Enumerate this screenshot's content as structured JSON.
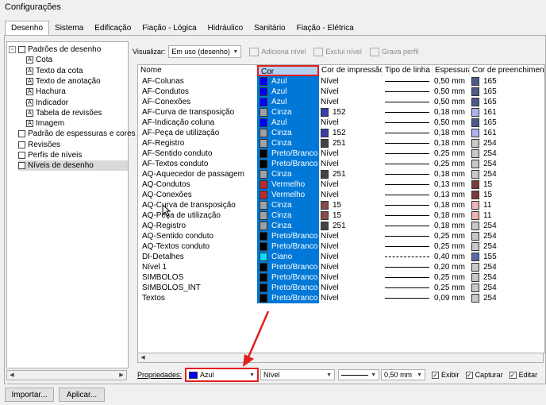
{
  "window": {
    "title": "Configurações"
  },
  "tabs": [
    "Desenho",
    "Sistema",
    "Edificação",
    "Fiação - Lógica",
    "Hidráulico",
    "Sanitário",
    "Fiação - Elétrica"
  ],
  "tree": {
    "items": [
      {
        "label": "Padrões de desenho",
        "icon": "folder-icon",
        "level": 0,
        "expanded": true
      },
      {
        "label": "Cota",
        "icon": "dimension-icon",
        "level": 1
      },
      {
        "label": "Texto da cota",
        "icon": "text-icon",
        "level": 1
      },
      {
        "label": "Texto de anotação",
        "icon": "text-icon",
        "level": 1
      },
      {
        "label": "Hachura",
        "icon": "hatch-icon",
        "level": 1
      },
      {
        "label": "Indicador",
        "icon": "indicator-icon",
        "level": 1
      },
      {
        "label": "Tabela de revisões",
        "icon": "table-icon",
        "level": 1
      },
      {
        "label": "Imagem",
        "icon": "image-icon",
        "level": 1
      },
      {
        "label": "Padrão de espessuras e cores",
        "icon": "style-icon",
        "level": 0
      },
      {
        "label": "Revisões",
        "icon": "style-icon",
        "level": 0
      },
      {
        "label": "Perfis de níveis",
        "icon": "style-icon",
        "level": 0
      },
      {
        "label": "Níveis de desenho",
        "icon": "style-icon",
        "level": 0,
        "selected": true
      }
    ]
  },
  "toolbar": {
    "visualizar_label": "Visualizar:",
    "visualizar_value": "Em uso (desenho)",
    "adiciona": "Adiciona nível",
    "exclui": "Exclui nível",
    "grava": "Grava perfil"
  },
  "grid": {
    "columns": [
      "Nome",
      "Cor",
      "Cor de impressão",
      "Tipo de linha",
      "Espessura",
      "Cor de preenchimento"
    ],
    "rows": [
      {
        "nome": "AF-Colunas",
        "cor": "Azul",
        "cor_hex": "#0000ff",
        "impressao": "Nível",
        "imp_hex": "",
        "linha": "solid",
        "esp": "0,50 mm",
        "preench": "165",
        "pre_hex": "#4a5a8a"
      },
      {
        "nome": "AF-Condutos",
        "cor": "Azul",
        "cor_hex": "#0000ff",
        "impressao": "Nível",
        "imp_hex": "",
        "linha": "solid",
        "esp": "0,50 mm",
        "preench": "165",
        "pre_hex": "#4a5a8a"
      },
      {
        "nome": "AF-Conexões",
        "cor": "Azul",
        "cor_hex": "#0000ff",
        "impressao": "Nível",
        "imp_hex": "",
        "linha": "solid",
        "esp": "0,50 mm",
        "preench": "165",
        "pre_hex": "#4a5a8a"
      },
      {
        "nome": "AF-Curva de transposição",
        "cor": "Cinza",
        "cor_hex": "#a0a0a0",
        "impressao": "152",
        "imp_hex": "#3b3fa8",
        "linha": "solid",
        "esp": "0,18 mm",
        "preench": "161",
        "pre_hex": "#aab4f0"
      },
      {
        "nome": "AF-Indicação coluna",
        "cor": "Azul",
        "cor_hex": "#0000ff",
        "impressao": "Nível",
        "imp_hex": "",
        "linha": "solid",
        "esp": "0,50 mm",
        "preench": "165",
        "pre_hex": "#4a5a8a"
      },
      {
        "nome": "AF-Peça de utilização",
        "cor": "Cinza",
        "cor_hex": "#a0a0a0",
        "impressao": "152",
        "imp_hex": "#3b3fa8",
        "linha": "solid",
        "esp": "0,18 mm",
        "preench": "161",
        "pre_hex": "#aab4f0"
      },
      {
        "nome": "AF-Registro",
        "cor": "Cinza",
        "cor_hex": "#a0a0a0",
        "impressao": "251",
        "imp_hex": "#444444",
        "linha": "solid",
        "esp": "0,18 mm",
        "preench": "254",
        "pre_hex": "#c8c8c8"
      },
      {
        "nome": "AF-Sentido conduto",
        "cor": "Preto/Branco",
        "cor_hex": "#000000",
        "impressao": "Nível",
        "imp_hex": "",
        "linha": "solid",
        "esp": "0,25 mm",
        "preench": "254",
        "pre_hex": "#c8c8c8"
      },
      {
        "nome": "AF-Textos conduto",
        "cor": "Preto/Branco",
        "cor_hex": "#000000",
        "impressao": "Nível",
        "imp_hex": "",
        "linha": "solid",
        "esp": "0,25 mm",
        "preench": "254",
        "pre_hex": "#c8c8c8"
      },
      {
        "nome": "AQ-Aquecedor de passagem",
        "cor": "Cinza",
        "cor_hex": "#a0a0a0",
        "impressao": "251",
        "imp_hex": "#444444",
        "linha": "solid",
        "esp": "0,18 mm",
        "preench": "254",
        "pre_hex": "#c8c8c8"
      },
      {
        "nome": "AQ-Condutos",
        "cor": "Vermelho",
        "cor_hex": "#c0282d",
        "impressao": "Nível",
        "imp_hex": "",
        "linha": "solid",
        "esp": "0,13 mm",
        "preench": "15",
        "pre_hex": "#7a3a3a"
      },
      {
        "nome": "AQ-Conexões",
        "cor": "Vermelho",
        "cor_hex": "#c0282d",
        "impressao": "Nível",
        "imp_hex": "",
        "linha": "solid",
        "esp": "0,13 mm",
        "preench": "15",
        "pre_hex": "#7a3a3a"
      },
      {
        "nome": "AQ-Curva de transposição",
        "cor": "Cinza",
        "cor_hex": "#a0a0a0",
        "impressao": "15",
        "imp_hex": "#8a4a4a",
        "linha": "solid",
        "esp": "0,18 mm",
        "preench": "11",
        "pre_hex": "#f0b4b4"
      },
      {
        "nome": "AQ-Peça de utilização",
        "cor": "Cinza",
        "cor_hex": "#a0a0a0",
        "impressao": "15",
        "imp_hex": "#8a4a4a",
        "linha": "solid",
        "esp": "0,18 mm",
        "preench": "11",
        "pre_hex": "#f0b4b4"
      },
      {
        "nome": "AQ-Registro",
        "cor": "Cinza",
        "cor_hex": "#a0a0a0",
        "impressao": "251",
        "imp_hex": "#444444",
        "linha": "solid",
        "esp": "0,18 mm",
        "preench": "254",
        "pre_hex": "#c8c8c8"
      },
      {
        "nome": "AQ-Sentido conduto",
        "cor": "Preto/Branco",
        "cor_hex": "#000000",
        "impressao": "Nível",
        "imp_hex": "",
        "linha": "solid",
        "esp": "0,25 mm",
        "preench": "254",
        "pre_hex": "#c8c8c8"
      },
      {
        "nome": "AQ-Textos conduto",
        "cor": "Preto/Branco",
        "cor_hex": "#000000",
        "impressao": "Nível",
        "imp_hex": "",
        "linha": "solid",
        "esp": "0,25 mm",
        "preench": "254",
        "pre_hex": "#c8c8c8"
      },
      {
        "nome": "DI-Detalhes",
        "cor": "Ciano",
        "cor_hex": "#00e0ff",
        "impressao": "Nível",
        "imp_hex": "",
        "linha": "dashed",
        "esp": "0,40 mm",
        "preench": "155",
        "pre_hex": "#5a6aa8"
      },
      {
        "nome": "Nível 1",
        "cor": "Preto/Branco",
        "cor_hex": "#000000",
        "impressao": "Nível",
        "imp_hex": "",
        "linha": "solid",
        "esp": "0,20 mm",
        "preench": "254",
        "pre_hex": "#c8c8c8"
      },
      {
        "nome": "SIMBOLOS",
        "cor": "Preto/Branco",
        "cor_hex": "#000000",
        "impressao": "Nível",
        "imp_hex": "",
        "linha": "solid",
        "esp": "0,25 mm",
        "preench": "254",
        "pre_hex": "#c8c8c8"
      },
      {
        "nome": "SIMBOLOS_INT",
        "cor": "Preto/Branco",
        "cor_hex": "#000000",
        "impressao": "Nível",
        "imp_hex": "",
        "linha": "solid",
        "esp": "0,25 mm",
        "preench": "254",
        "pre_hex": "#c8c8c8"
      },
      {
        "nome": "Textos",
        "cor": "Preto/Branco",
        "cor_hex": "#000000",
        "impressao": "Nível",
        "imp_hex": "",
        "linha": "solid",
        "esp": "0,09 mm",
        "preench": "254",
        "pre_hex": "#c8c8c8"
      }
    ]
  },
  "properties": {
    "label": "Propriedades:",
    "color_value": "Azul",
    "color_hex": "#0000ff",
    "print_value": "Nível",
    "thickness": "0,50 mm",
    "exibir": "Exibir",
    "capturar": "Capturar",
    "editar": "Editar"
  },
  "buttons": {
    "importar": "Importar...",
    "aplicar": "Aplicar..."
  },
  "colors": {
    "accent": "#0078d7",
    "highlight": "#e0201c"
  }
}
